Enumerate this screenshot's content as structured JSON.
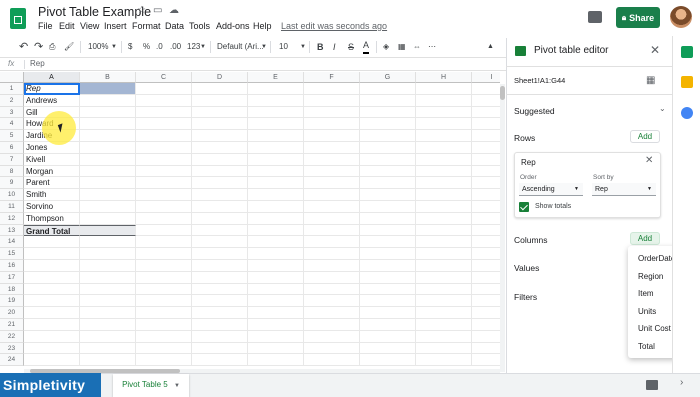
{
  "header": {
    "title": "Pivot Table Example",
    "menu": [
      "File",
      "Edit",
      "View",
      "Insert",
      "Format",
      "Data",
      "Tools",
      "Add-ons",
      "Help"
    ],
    "last_edit": "Last edit was seconds ago",
    "share_label": "Share"
  },
  "toolbar": {
    "zoom": "100%",
    "currency": "$",
    "percent": "%",
    "decimal_less": ".0",
    "decimal_more": ".00",
    "format_more": "123",
    "font": "Default (Ari...",
    "font_size": "10",
    "bold": "B",
    "italic": "I",
    "strike": "S",
    "text_color": "A"
  },
  "formula": {
    "fx": "fx",
    "value": "Rep"
  },
  "sheet": {
    "columns": [
      "A",
      "B",
      "C",
      "D",
      "E",
      "F",
      "G",
      "H",
      "I"
    ],
    "rows": [
      "1",
      "2",
      "3",
      "4",
      "5",
      "6",
      "7",
      "8",
      "9",
      "10",
      "11",
      "12",
      "13",
      "14",
      "15",
      "16",
      "17",
      "18",
      "19",
      "20",
      "21",
      "22",
      "23",
      "24"
    ],
    "cells": [
      "Rep",
      "Andrews",
      "Gill",
      "Howard",
      "Jardine",
      "Jones",
      "Kivell",
      "Morgan",
      "Parent",
      "Smith",
      "Sorvino",
      "Thompson",
      "Grand Total"
    ]
  },
  "bottom": {
    "brand": "Simpletivity",
    "tab_label": "Pivot Table 5"
  },
  "panel": {
    "title": "Pivot table editor",
    "range": "Sheet1!A1:G44",
    "suggested": "Suggested",
    "rows_label": "Rows",
    "add": "Add",
    "card_title": "Rep",
    "order_label": "Order",
    "order_value": "Ascending",
    "sortby_label": "Sort by",
    "sortby_value": "Rep",
    "show_totals": "Show totals",
    "columns_label": "Columns",
    "values_label": "Values",
    "filters_label": "Filters",
    "dropdown": [
      "OrderDate",
      "Region",
      "Item",
      "Units",
      "Unit Cost",
      "Total"
    ]
  },
  "colors": {
    "brand_green": "#188038",
    "share_green": "#1a7f4b",
    "selection_blue": "#a4b6d3",
    "brand_blue": "#1a6fb5"
  }
}
